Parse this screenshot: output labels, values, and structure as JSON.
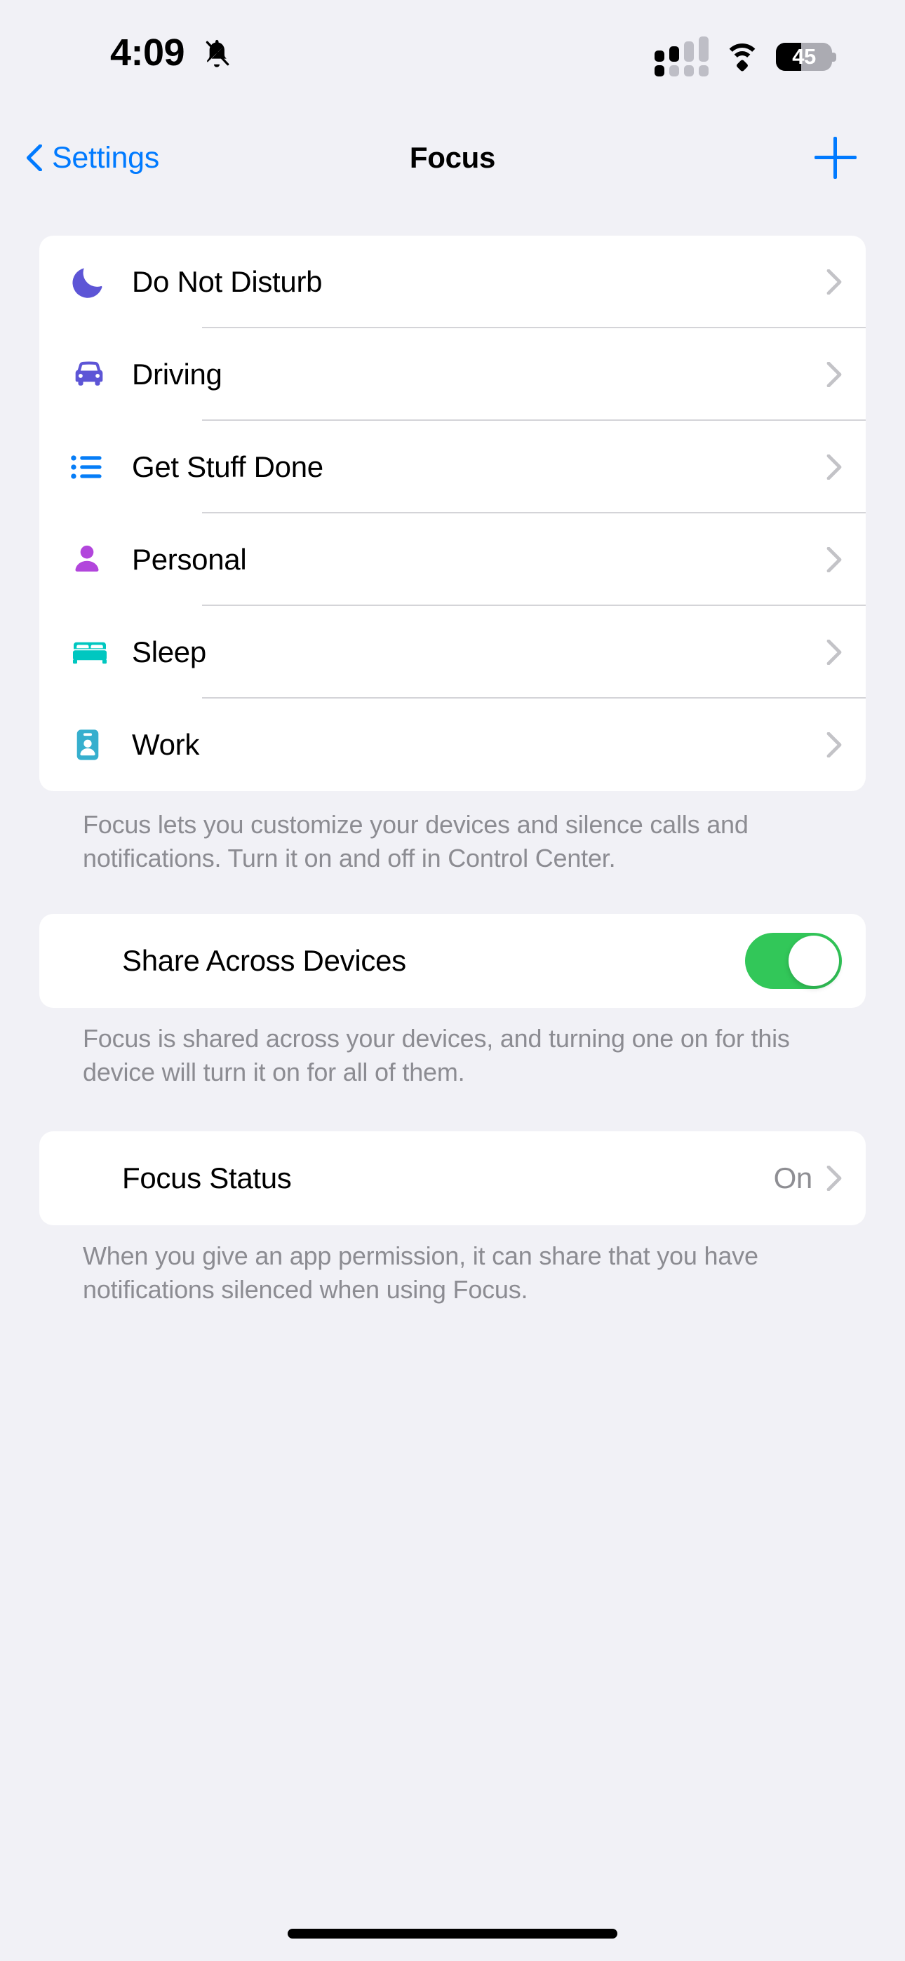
{
  "status_bar": {
    "time": "4:09",
    "silent_icon": "bell-slash-icon",
    "cellular_icon": "cellular-signal-icon",
    "cellular_bars_active": 2,
    "cellular_bars_total": 4,
    "wifi_icon": "wifi-icon",
    "battery_icon": "battery-icon",
    "battery_percent": "45"
  },
  "nav": {
    "back_label": "Settings",
    "title": "Focus",
    "add_icon": "plus-icon",
    "back_icon": "chevron-left-icon"
  },
  "focus_list": {
    "items": [
      {
        "label": "Do Not Disturb",
        "icon": "moon-icon",
        "color": "#5D55D6"
      },
      {
        "label": "Driving",
        "icon": "car-icon",
        "color": "#5D55D6"
      },
      {
        "label": "Get Stuff Done",
        "icon": "list-bullet-icon",
        "color": "#067DF7"
      },
      {
        "label": "Personal",
        "icon": "person-icon",
        "color": "#B246DC"
      },
      {
        "label": "Sleep",
        "icon": "bed-icon",
        "color": "#00C7C0"
      },
      {
        "label": "Work",
        "icon": "id-badge-icon",
        "color": "#36AFCE"
      }
    ],
    "footer": "Focus lets you customize your devices and silence calls and notifications. Turn it on and off in Control Center."
  },
  "share_section": {
    "label": "Share Across Devices",
    "toggle_state": "on",
    "toggle_color": "#32C759",
    "footer": "Focus is shared across your devices, and turning one on for this device will turn it on for all of them."
  },
  "focus_status_section": {
    "label": "Focus Status",
    "value": "On",
    "footer": "When you give an app permission, it can share that you have notifications silenced when using Focus."
  },
  "colors": {
    "page_background": "#F1F1F6",
    "card_background": "#FFFFFF",
    "accent_blue": "#007AFF",
    "secondary_text": "#8E8E93",
    "separator": "#D4D4D8"
  }
}
